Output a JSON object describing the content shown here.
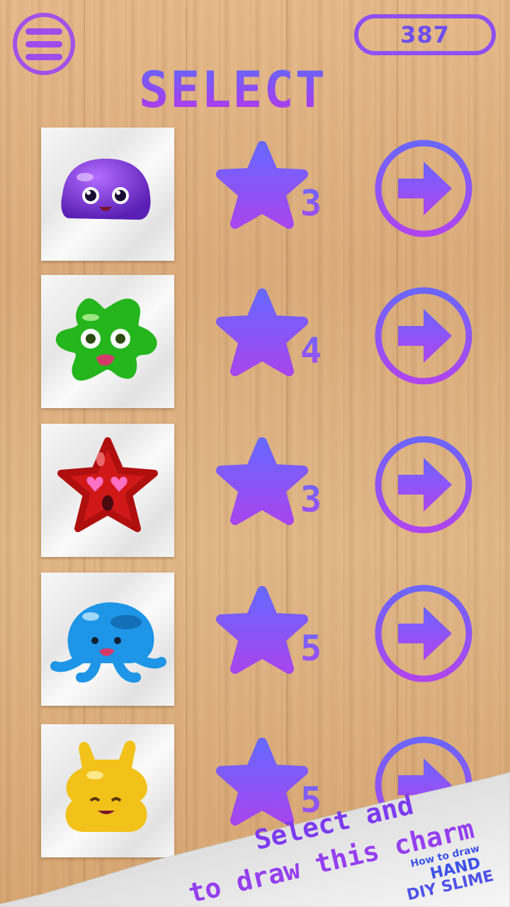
{
  "header": {
    "score": "387",
    "title": "SELECT"
  },
  "items": [
    {
      "name": "purple-blob-slime",
      "rating": "3"
    },
    {
      "name": "green-splat-slime",
      "rating": "4"
    },
    {
      "name": "red-star-slime",
      "rating": "3"
    },
    {
      "name": "blue-octopus-slime",
      "rating": "5"
    },
    {
      "name": "yellow-cat-slime",
      "rating": "5"
    }
  ],
  "promo": {
    "line1": "Select and",
    "line2": "to draw this charm",
    "brand_small": "How to draw",
    "brand_mid": "HAND",
    "brand_big": "DIY SLIME"
  },
  "colors": {
    "accent": "#8e4ef0",
    "accent_blue": "#5f66ff",
    "wood": "#e0b483"
  }
}
